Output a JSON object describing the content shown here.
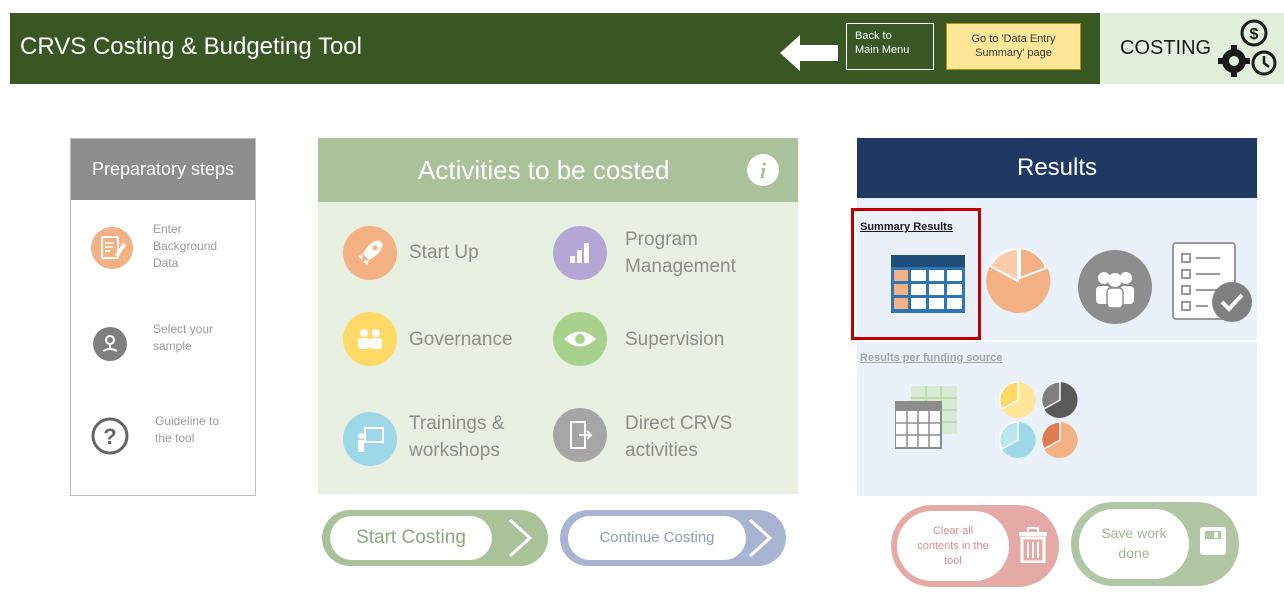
{
  "header": {
    "title": "CRVS Costing & Budgeting Tool",
    "back_button": [
      "Back to",
      "Main Menu"
    ],
    "goto_button": [
      "Go to 'Data Entry",
      "Summary' page"
    ],
    "mode_label": "COSTING",
    "background_color": "#385723",
    "icons": [
      "back-arrow-icon",
      "costing-gears-icon"
    ]
  },
  "preparatory": {
    "title": "Preparatory steps",
    "items": [
      {
        "label": [
          "Enter",
          "Background",
          "Data"
        ],
        "icon": "edit-form-icon",
        "color": "#f4b183"
      },
      {
        "label": [
          "Select your",
          "sample"
        ],
        "icon": "map-pin-icon",
        "color": "#7f7f7f"
      },
      {
        "label": [
          "Guideline to",
          "the tool"
        ],
        "icon": "question-icon",
        "color": "#7f7f7f"
      }
    ]
  },
  "activities": {
    "title": "Activities to be costed",
    "info_icon": "info-icon",
    "items": [
      {
        "label": [
          "Start Up"
        ],
        "icon": "rocket-icon",
        "color": "#f4b183"
      },
      {
        "label": [
          "Program",
          "Management"
        ],
        "icon": "bar-chart-icon",
        "color": "#b4a7d6"
      },
      {
        "label": [
          "Governance"
        ],
        "icon": "people-icon",
        "color": "#ffd966"
      },
      {
        "label": [
          "Supervision"
        ],
        "icon": "eye-icon",
        "color": "#a9d18e"
      },
      {
        "label": [
          "Trainings &",
          "workshops"
        ],
        "icon": "training-icon",
        "color": "#9dd8e8"
      },
      {
        "label": [
          "Direct CRVS",
          "activities"
        ],
        "icon": "document-exit-icon",
        "color": "#a6a6a6"
      }
    ],
    "start_button": "Start Costing",
    "continue_button": "Continue Costing"
  },
  "results": {
    "title": "Results",
    "summary_label": "Summary Results",
    "funding_label": "Results per funding source",
    "summary_icons": [
      "table-icon",
      "pie-chart-icon",
      "group-icon",
      "checklist-icon"
    ],
    "funding_icons": [
      "spreadsheet-icon",
      "multi-pie-icon"
    ],
    "clear_button": [
      "Clear all",
      "contents in the",
      "tool"
    ],
    "save_button": [
      "Save work",
      "done"
    ],
    "header_color": "#203864",
    "highlight_color": "#c00000"
  }
}
